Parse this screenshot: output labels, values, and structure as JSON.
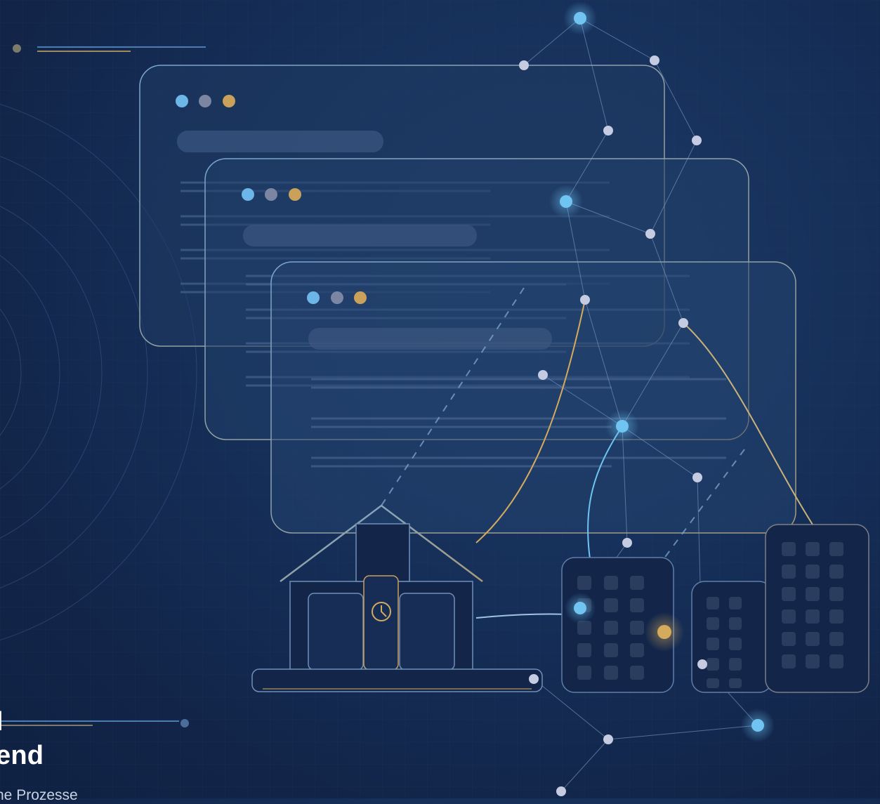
{
  "hero": {
    "title_line_1": "l",
    "title_line_2": "end",
    "subtitle": "he Prozesse"
  },
  "illustration": {
    "window_dot_colors": [
      "#6cb6e8",
      "#7c86a2",
      "#c9a15a"
    ],
    "accent_blue": "#6fc4f2",
    "accent_gold": "#d4aa5c",
    "node_color": "#c5cbe0",
    "line_color": "#7f9cc7",
    "icons": [
      "house-icon",
      "clock-icon",
      "office-building-icon"
    ]
  }
}
